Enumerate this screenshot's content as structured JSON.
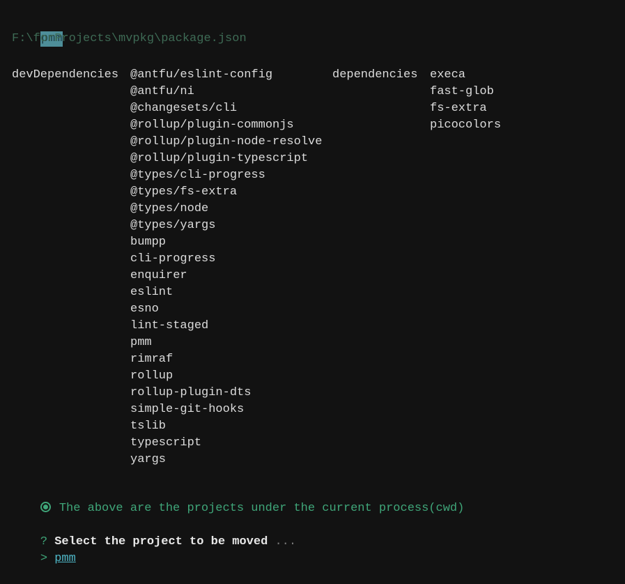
{
  "header": {
    "project_name": "pmm",
    "package_path": "F:\\forProjects\\mvpkg\\package.json"
  },
  "dev_dependencies": {
    "label": "devDependencies",
    "items": [
      "@antfu/eslint-config",
      "@antfu/ni",
      "@changesets/cli",
      "@rollup/plugin-commonjs",
      "@rollup/plugin-node-resolve",
      "@rollup/plugin-typescript",
      "@types/cli-progress",
      "@types/fs-extra",
      "@types/node",
      "@types/yargs",
      "bumpp",
      "cli-progress",
      "enquirer",
      "eslint",
      "esno",
      "lint-staged",
      "pmm",
      "rimraf",
      "rollup",
      "rollup-plugin-dts",
      "simple-git-hooks",
      "tslib",
      "typescript",
      "yargs"
    ]
  },
  "dependencies": {
    "label": "dependencies",
    "items": [
      "execa",
      "fast-glob",
      "fs-extra",
      "picocolors"
    ]
  },
  "info": {
    "icon": "radio-dot-icon",
    "text": "The above are the projects under the current process(cwd)"
  },
  "prompt": {
    "symbol": "?",
    "question": "Select the project to be moved",
    "ellipsis": "...",
    "pointer": ">",
    "selected": "pmm"
  },
  "colors": {
    "background": "#121212",
    "accent_green": "#3fa679",
    "choice_cyan": "#4fb8c8",
    "badge": "#4e8e99"
  }
}
